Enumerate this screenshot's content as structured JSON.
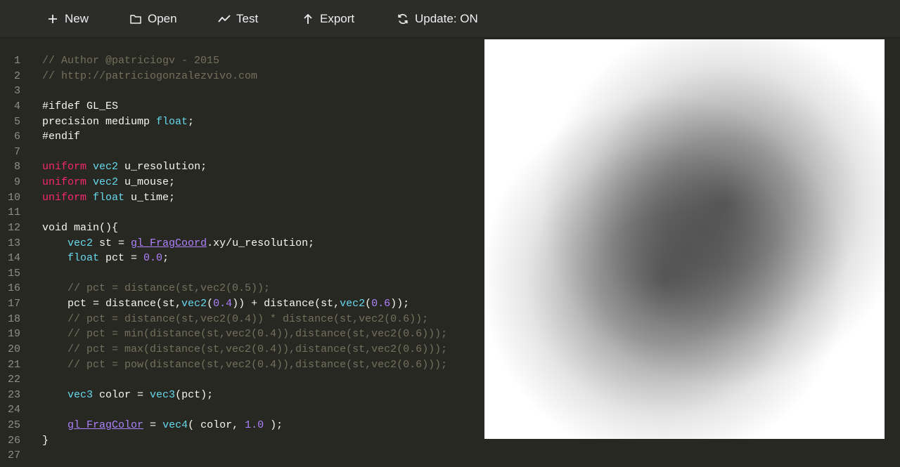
{
  "toolbar": {
    "new_label": "New",
    "open_label": "Open",
    "test_label": "Test",
    "export_label": "Export",
    "update_label": "Update: ON"
  },
  "editor": {
    "lines": [
      {
        "n": "1",
        "tokens": [
          {
            "t": "// Author @patriciogv - 2015",
            "c": "cm"
          }
        ]
      },
      {
        "n": "2",
        "tokens": [
          {
            "t": "// http://patriciogonzalezvivo.com",
            "c": "cm"
          }
        ]
      },
      {
        "n": "3",
        "tokens": []
      },
      {
        "n": "4",
        "tokens": [
          {
            "t": "#ifdef GL_ES",
            "c": "tx"
          }
        ]
      },
      {
        "n": "5",
        "tokens": [
          {
            "t": "precision mediump ",
            "c": "tx"
          },
          {
            "t": "float",
            "c": "ty"
          },
          {
            "t": ";",
            "c": "tx"
          }
        ]
      },
      {
        "n": "6",
        "tokens": [
          {
            "t": "#endif",
            "c": "tx"
          }
        ]
      },
      {
        "n": "7",
        "tokens": []
      },
      {
        "n": "8",
        "tokens": [
          {
            "t": "uniform",
            "c": "kw"
          },
          {
            "t": " ",
            "c": "tx"
          },
          {
            "t": "vec2",
            "c": "ty"
          },
          {
            "t": " u_resolution;",
            "c": "tx"
          }
        ]
      },
      {
        "n": "9",
        "tokens": [
          {
            "t": "uniform",
            "c": "kw"
          },
          {
            "t": " ",
            "c": "tx"
          },
          {
            "t": "vec2",
            "c": "ty"
          },
          {
            "t": " u_mouse;",
            "c": "tx"
          }
        ]
      },
      {
        "n": "10",
        "tokens": [
          {
            "t": "uniform",
            "c": "kw"
          },
          {
            "t": " ",
            "c": "tx"
          },
          {
            "t": "float",
            "c": "ty"
          },
          {
            "t": " u_time;",
            "c": "tx"
          }
        ]
      },
      {
        "n": "11",
        "tokens": []
      },
      {
        "n": "12",
        "tokens": [
          {
            "t": "void main(){",
            "c": "tx"
          }
        ]
      },
      {
        "n": "13",
        "tokens": [
          {
            "t": "    ",
            "c": "tx"
          },
          {
            "t": "vec2",
            "c": "ty"
          },
          {
            "t": " st = ",
            "c": "tx"
          },
          {
            "t": "gl_FragCoord",
            "c": "bi"
          },
          {
            "t": ".xy/u_resolution;",
            "c": "tx"
          }
        ]
      },
      {
        "n": "14",
        "tokens": [
          {
            "t": "    ",
            "c": "tx"
          },
          {
            "t": "float",
            "c": "ty"
          },
          {
            "t": " pct = ",
            "c": "tx"
          },
          {
            "t": "0.0",
            "c": "num"
          },
          {
            "t": ";",
            "c": "tx"
          }
        ]
      },
      {
        "n": "15",
        "tokens": []
      },
      {
        "n": "16",
        "tokens": [
          {
            "t": "    // pct = distance(st,vec2(0.5));",
            "c": "cm"
          }
        ]
      },
      {
        "n": "17",
        "tokens": [
          {
            "t": "    pct = distance(st,",
            "c": "tx"
          },
          {
            "t": "vec2",
            "c": "ty"
          },
          {
            "t": "(",
            "c": "tx"
          },
          {
            "t": "0.4",
            "c": "num"
          },
          {
            "t": ")) + distance(st,",
            "c": "tx"
          },
          {
            "t": "vec2",
            "c": "ty"
          },
          {
            "t": "(",
            "c": "tx"
          },
          {
            "t": "0.6",
            "c": "num"
          },
          {
            "t": "));",
            "c": "tx"
          }
        ]
      },
      {
        "n": "18",
        "tokens": [
          {
            "t": "    // pct = distance(st,vec2(0.4)) * distance(st,vec2(0.6));",
            "c": "cm"
          }
        ]
      },
      {
        "n": "19",
        "tokens": [
          {
            "t": "    // pct = min(distance(st,vec2(0.4)),distance(st,vec2(0.6)));",
            "c": "cm"
          }
        ]
      },
      {
        "n": "20",
        "tokens": [
          {
            "t": "    // pct = max(distance(st,vec2(0.4)),distance(st,vec2(0.6)));",
            "c": "cm"
          }
        ]
      },
      {
        "n": "21",
        "tokens": [
          {
            "t": "    // pct = pow(distance(st,vec2(0.4)),distance(st,vec2(0.6)));",
            "c": "cm"
          }
        ]
      },
      {
        "n": "22",
        "tokens": []
      },
      {
        "n": "23",
        "tokens": [
          {
            "t": "    ",
            "c": "tx"
          },
          {
            "t": "vec3",
            "c": "ty"
          },
          {
            "t": " color = ",
            "c": "tx"
          },
          {
            "t": "vec3",
            "c": "ty"
          },
          {
            "t": "(pct);",
            "c": "tx"
          }
        ]
      },
      {
        "n": "24",
        "tokens": []
      },
      {
        "n": "25",
        "tokens": [
          {
            "t": "    ",
            "c": "tx"
          },
          {
            "t": "gl_FragColor",
            "c": "bi"
          },
          {
            "t": " = ",
            "c": "tx"
          },
          {
            "t": "vec4",
            "c": "ty"
          },
          {
            "t": "( color, ",
            "c": "tx"
          },
          {
            "t": "1.0",
            "c": "num"
          },
          {
            "t": " );",
            "c": "tx"
          }
        ]
      },
      {
        "n": "26",
        "tokens": [
          {
            "t": "}",
            "c": "tx"
          }
        ]
      },
      {
        "n": "27",
        "tokens": []
      }
    ]
  },
  "colors": {
    "background": "#272822",
    "toolbar": "#2c2c2a",
    "comment": "#75715e",
    "keyword": "#f92672",
    "type": "#66d9ef",
    "number": "#ae81ff",
    "text": "#f8f8f2",
    "line_number": "#8f908a"
  },
  "icons": {
    "new": "plus-icon",
    "open": "folder-icon",
    "test": "chart-line-icon",
    "export": "arrow-up-icon",
    "update": "refresh-icon"
  }
}
